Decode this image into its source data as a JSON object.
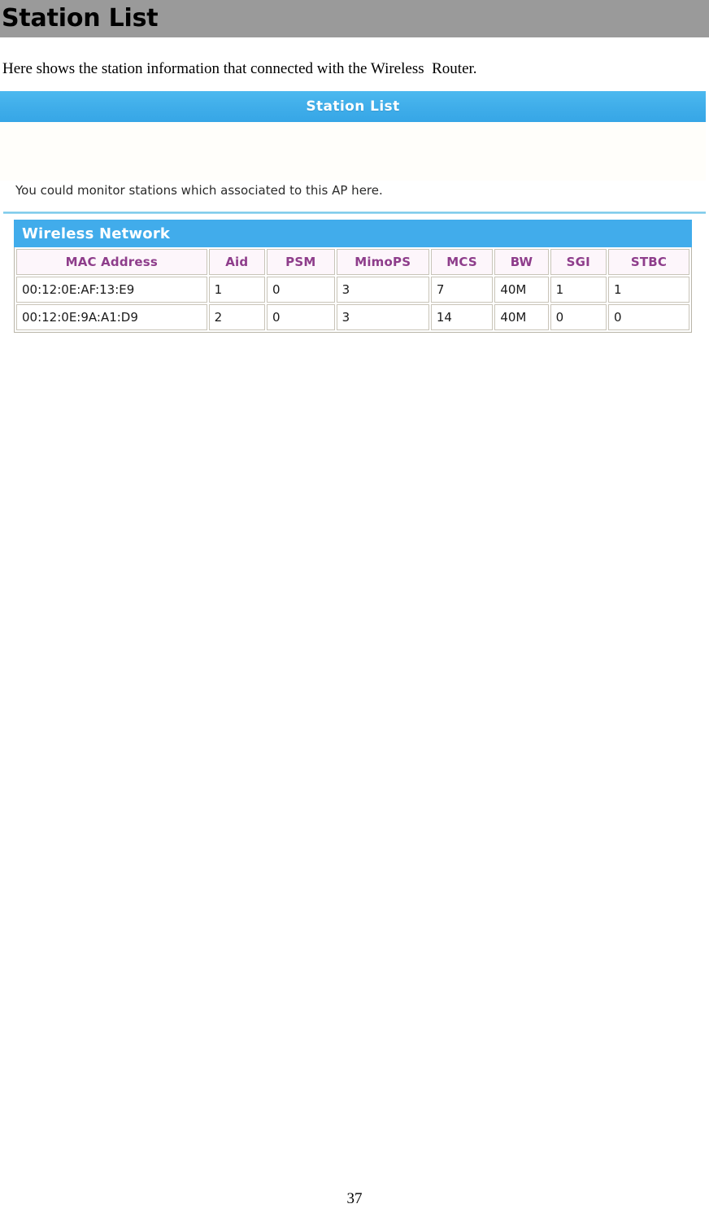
{
  "document": {
    "title": "Station List",
    "intro_text": "Here shows the station information that connected with the Wireless  Router.",
    "page_number": "37"
  },
  "panel": {
    "header_title": "Station List",
    "description": "You could monitor stations which associated to this AP here."
  },
  "table_section": {
    "title": "Wireless Network"
  },
  "chart_data": {
    "type": "table",
    "title": "Wireless Network",
    "columns": [
      "MAC Address",
      "Aid",
      "PSM",
      "MimoPS",
      "MCS",
      "BW",
      "SGI",
      "STBC"
    ],
    "rows": [
      [
        "00:12:0E:AF:13:E9",
        "1",
        "0",
        "3",
        "7",
        "40M",
        "1",
        "1"
      ],
      [
        "00:12:0E:9A:A1:D9",
        "2",
        "0",
        "3",
        "14",
        "40M",
        "0",
        "0"
      ]
    ]
  },
  "colors": {
    "title_bar_gray": "#9a9a9a",
    "panel_blue": "#41aceb",
    "table_header_text_purple": "#8e3d8b",
    "divider_blue": "#6fc4e8"
  }
}
